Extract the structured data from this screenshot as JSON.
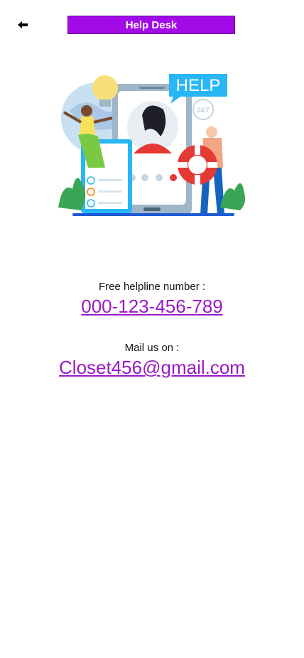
{
  "header": {
    "back_icon": "arrow-left-icon",
    "title": "Help Desk"
  },
  "hero": {
    "badge_text": "HELP",
    "badge_small": "24/7"
  },
  "contact": {
    "helpline_label": "Free helpline number :",
    "helpline_number": "000-123-456-789",
    "mail_label": "Mail us on :",
    "mail_address": "Closet456@gmail.com"
  },
  "colors": {
    "accent": "#a20be8",
    "link": "#9a19c4"
  }
}
